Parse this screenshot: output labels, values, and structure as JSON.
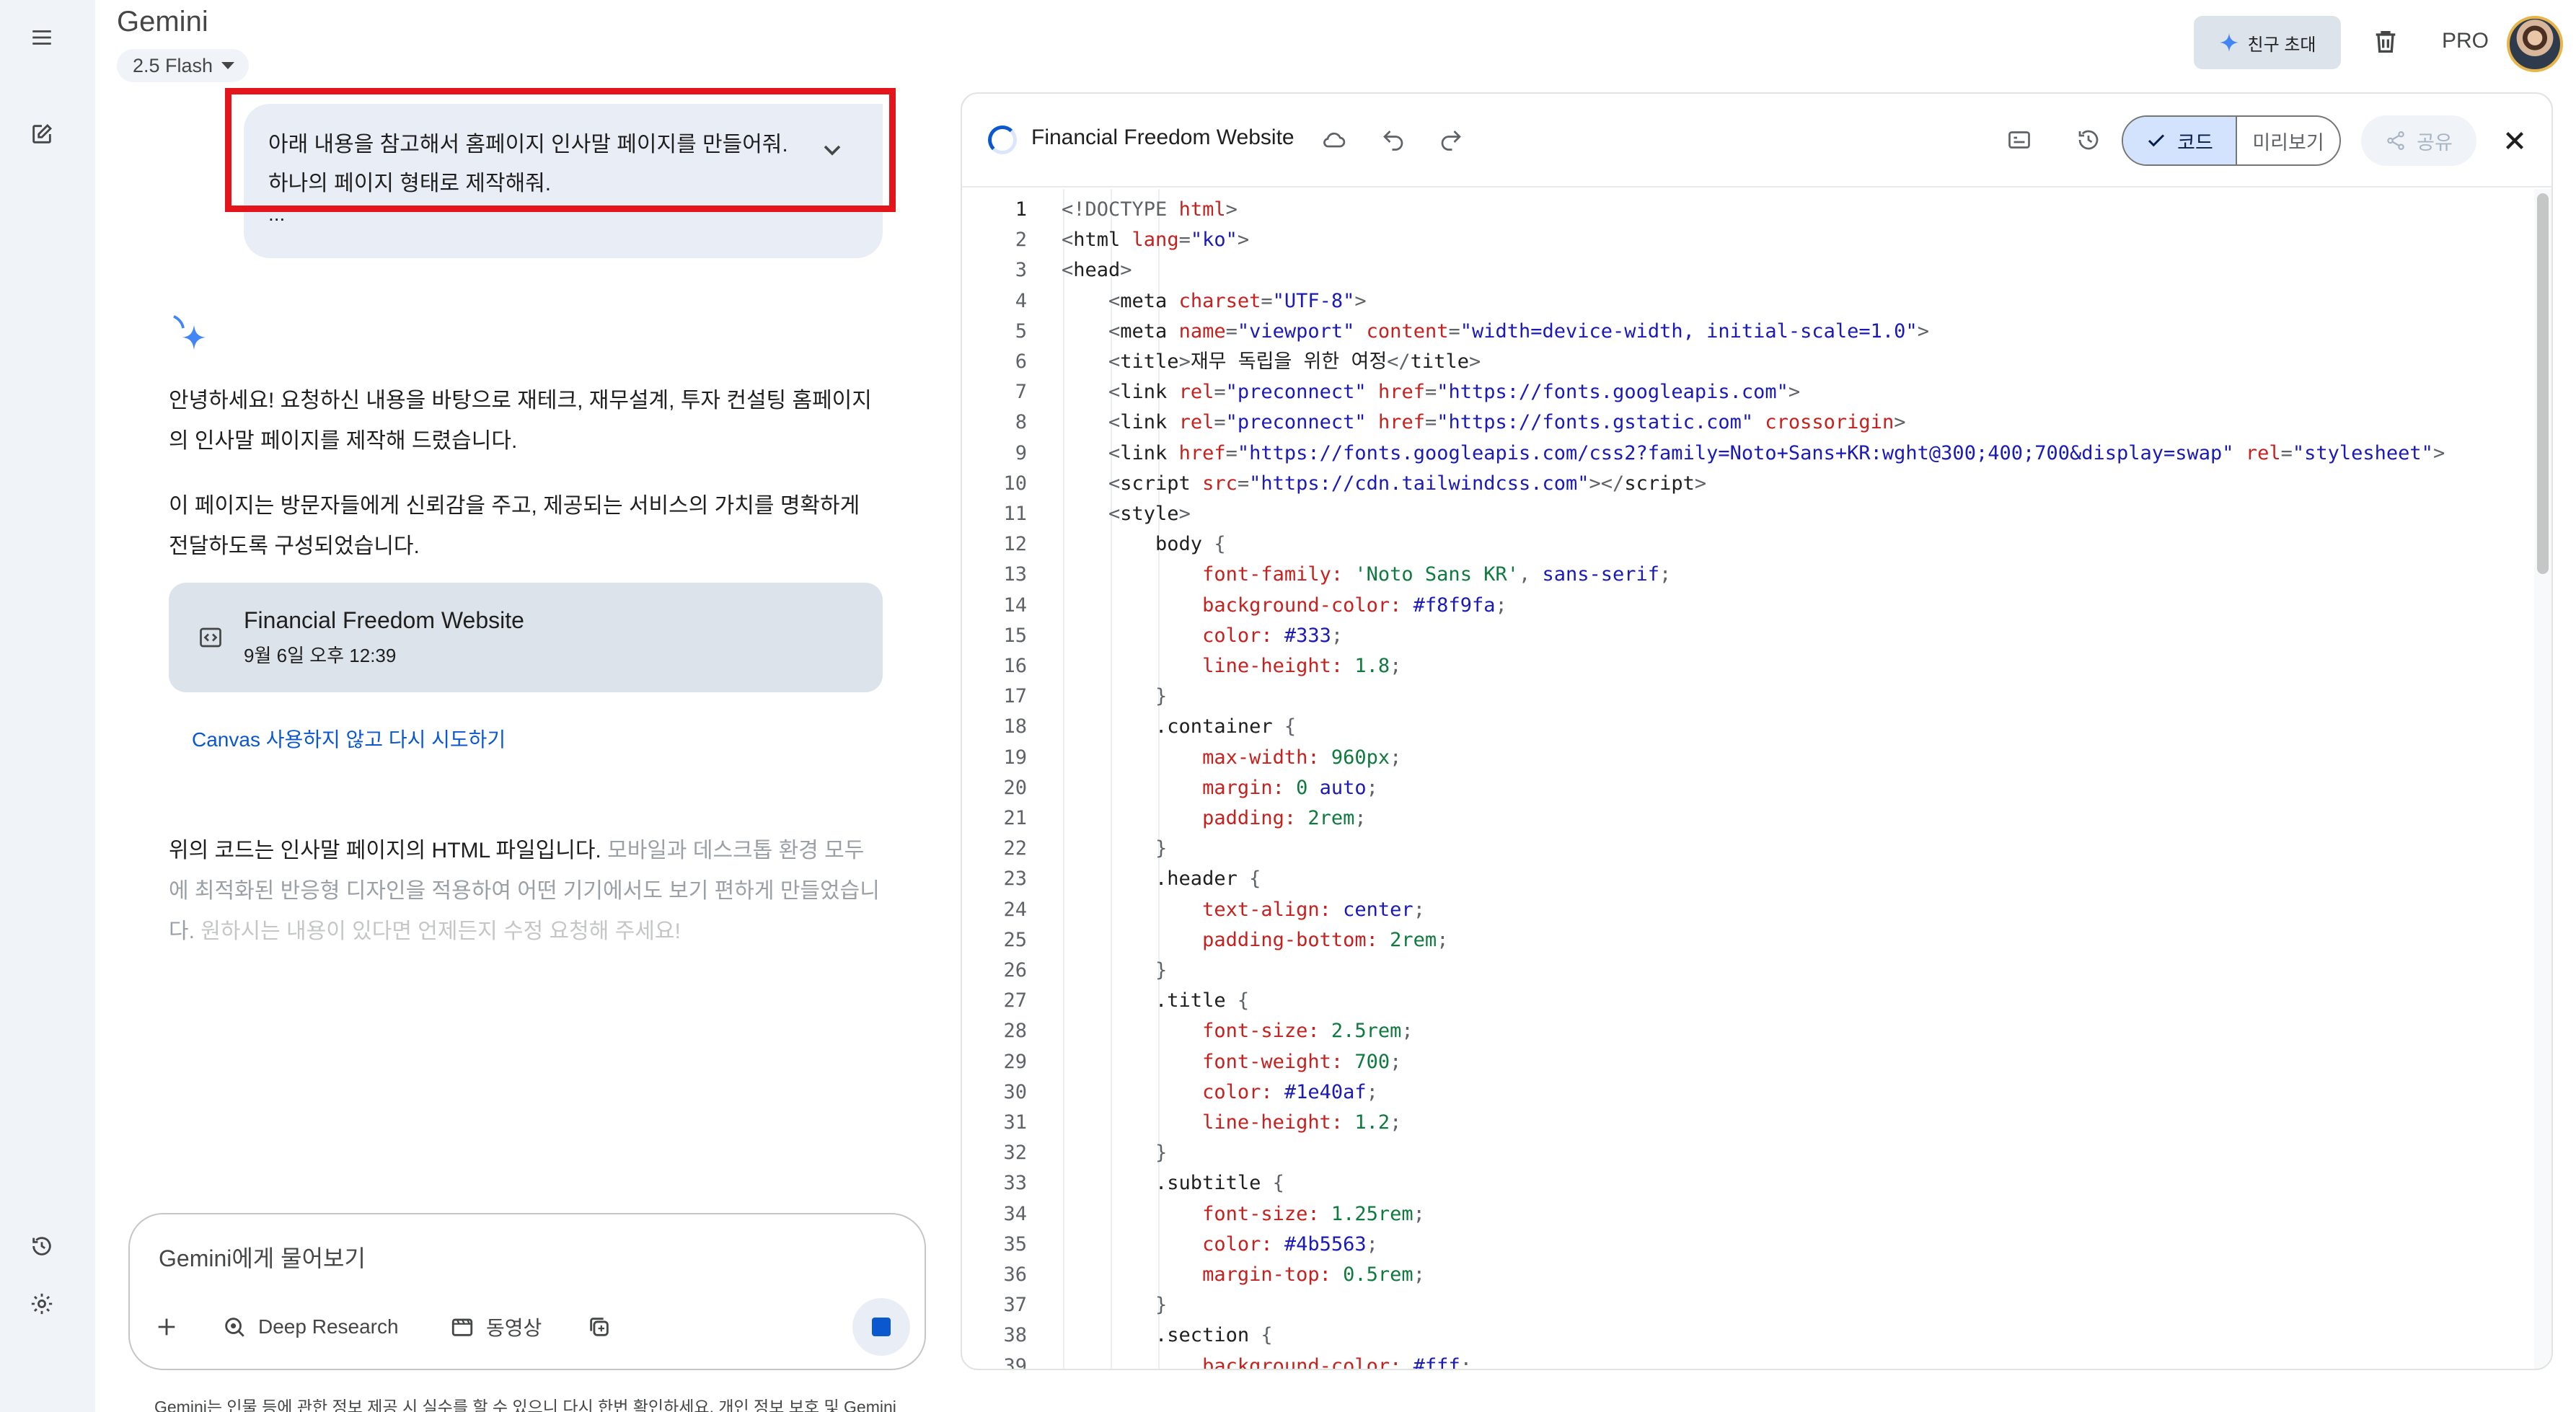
{
  "app": {
    "brand": "Gemini",
    "model_label": "2.5 Flash",
    "invite_label": "친구 초대",
    "plan_label": "PRO"
  },
  "chat": {
    "user_message_lines": [
      "아래 내용을 참고해서 홈페이지 인사말 페이지를 만들어줘.",
      "하나의 페이지 형태로 제작해줘.",
      "..."
    ],
    "response_p1_lines": [
      "안녕하세요! 요청하신 내용을 바탕으로 재테크, 재무설계, 투자 컨설팅 홈페이지",
      "의 인사말 페이지를 제작해 드렸습니다."
    ],
    "response_p2_lines": [
      "이 페이지는 방문자들에게 신뢰감을 주고, 제공되는 서비스의 가치를 명확하게",
      "전달하도록 구성되었습니다."
    ],
    "doc_card": {
      "title": "Financial Freedom Website",
      "date": "9월 6일 오후 12:39"
    },
    "retry_link": "Canvas 사용하지 않고 다시 시도하기",
    "response_p3": {
      "line1_a": "위의 코드는 인사말 페이지의 HTML 파일입니다. ",
      "line1_b": "모바일과 데스크톱 환경 모두",
      "line2": "에 최적화된 반응형 디자인을 적용하여 어떤 기기에서도 보기 편하게 만들었습니",
      "line3_a": "다. ",
      "line3_b": "원하시는 내용이 있다면 언제든지 수정 요청해 주세요!"
    }
  },
  "input": {
    "placeholder": "Gemini에게 물어보기",
    "tools": {
      "deep_research": "Deep Research",
      "video": "동영상"
    },
    "disclaimer": "Gemini는 인물 등에 관한 정보 제공 시 실수를 할 수 있으니 다시 한번 확인하세요. 개인 정보 보호 및 Gemini"
  },
  "canvas": {
    "title": "Financial Freedom Website",
    "code_tab": "코드",
    "preview_tab": "미리보기",
    "share_label": "공유",
    "code_lines": [
      [
        [
          "t-punc",
          "<!DOCTYPE "
        ],
        [
          "t-attr",
          "html"
        ],
        [
          "t-punc",
          ">"
        ]
      ],
      [
        [
          "t-punc",
          "<"
        ],
        [
          "t-tag",
          "html "
        ],
        [
          "t-attr",
          "lang"
        ],
        [
          "t-punc",
          "="
        ],
        [
          "t-str",
          "\"ko\""
        ],
        [
          "t-punc",
          ">"
        ]
      ],
      [
        [
          "t-punc",
          "<"
        ],
        [
          "t-tag",
          "head"
        ],
        [
          "t-punc",
          ">"
        ]
      ],
      [
        [
          "t-punc",
          "    <"
        ],
        [
          "t-tag",
          "meta "
        ],
        [
          "t-attr",
          "charset"
        ],
        [
          "t-punc",
          "="
        ],
        [
          "t-str",
          "\"UTF-8\""
        ],
        [
          "t-punc",
          ">"
        ]
      ],
      [
        [
          "t-punc",
          "    <"
        ],
        [
          "t-tag",
          "meta "
        ],
        [
          "t-attr",
          "name"
        ],
        [
          "t-punc",
          "="
        ],
        [
          "t-str",
          "\"viewport\" "
        ],
        [
          "t-attr",
          "content"
        ],
        [
          "t-punc",
          "="
        ],
        [
          "t-str",
          "\"width=device-width, initial-scale=1.0\""
        ],
        [
          "t-punc",
          ">"
        ]
      ],
      [
        [
          "t-punc",
          "    <"
        ],
        [
          "t-tag",
          "title"
        ],
        [
          "t-punc",
          ">"
        ],
        [
          "t-tag",
          "재무 독립을 위한 여정"
        ],
        [
          "t-punc",
          "</"
        ],
        [
          "t-tag",
          "title"
        ],
        [
          "t-punc",
          ">"
        ]
      ],
      [
        [
          "t-punc",
          "    <"
        ],
        [
          "t-tag",
          "link "
        ],
        [
          "t-attr",
          "rel"
        ],
        [
          "t-punc",
          "="
        ],
        [
          "t-str",
          "\"preconnect\" "
        ],
        [
          "t-attr",
          "href"
        ],
        [
          "t-punc",
          "="
        ],
        [
          "t-str",
          "\"https://fonts.googleapis.com\""
        ],
        [
          "t-punc",
          ">"
        ]
      ],
      [
        [
          "t-punc",
          "    <"
        ],
        [
          "t-tag",
          "link "
        ],
        [
          "t-attr",
          "rel"
        ],
        [
          "t-punc",
          "="
        ],
        [
          "t-str",
          "\"preconnect\" "
        ],
        [
          "t-attr",
          "href"
        ],
        [
          "t-punc",
          "="
        ],
        [
          "t-str",
          "\"https://fonts.gstatic.com\" "
        ],
        [
          "t-attr",
          "crossorigin"
        ],
        [
          "t-punc",
          ">"
        ]
      ],
      [
        [
          "t-punc",
          "    <"
        ],
        [
          "t-tag",
          "link "
        ],
        [
          "t-attr",
          "href"
        ],
        [
          "t-punc",
          "="
        ],
        [
          "t-str",
          "\"https://fonts.googleapis.com/css2?family=Noto+Sans+KR:wght@300;400;700&display=swap\" "
        ],
        [
          "t-attr",
          "rel"
        ],
        [
          "t-punc",
          "="
        ],
        [
          "t-str",
          "\"stylesheet\""
        ],
        [
          "t-punc",
          ">"
        ]
      ],
      [
        [
          "t-punc",
          "    <"
        ],
        [
          "t-tag",
          "script "
        ],
        [
          "t-attr",
          "src"
        ],
        [
          "t-punc",
          "="
        ],
        [
          "t-str",
          "\"https://cdn.tailwindcss.com\""
        ],
        [
          "t-punc",
          "></"
        ],
        [
          "t-tag",
          "script"
        ],
        [
          "t-punc",
          ">"
        ]
      ],
      [
        [
          "t-punc",
          "    <"
        ],
        [
          "t-tag",
          "style"
        ],
        [
          "t-punc",
          ">"
        ]
      ],
      [
        [
          "t-sel",
          "        body "
        ],
        [
          "t-punc",
          "{"
        ]
      ],
      [
        [
          "t-prop",
          "            font-family: "
        ],
        [
          "t-val",
          "'Noto Sans KR'"
        ],
        [
          "t-punc",
          ", "
        ],
        [
          "t-str",
          "sans-serif"
        ],
        [
          "t-punc",
          ";"
        ]
      ],
      [
        [
          "t-prop",
          "            background-color: "
        ],
        [
          "t-str",
          "#f8f9fa"
        ],
        [
          "t-punc",
          ";"
        ]
      ],
      [
        [
          "t-prop",
          "            color: "
        ],
        [
          "t-str",
          "#333"
        ],
        [
          "t-punc",
          ";"
        ]
      ],
      [
        [
          "t-prop",
          "            line-height: "
        ],
        [
          "t-num",
          "1.8"
        ],
        [
          "t-punc",
          ";"
        ]
      ],
      [
        [
          "t-punc",
          "        }"
        ]
      ],
      [
        [
          "t-sel",
          "        .container "
        ],
        [
          "t-punc",
          "{"
        ]
      ],
      [
        [
          "t-prop",
          "            max-width: "
        ],
        [
          "t-num",
          "960px"
        ],
        [
          "t-punc",
          ";"
        ]
      ],
      [
        [
          "t-prop",
          "            margin: "
        ],
        [
          "t-num",
          "0 "
        ],
        [
          "t-str",
          "auto"
        ],
        [
          "t-punc",
          ";"
        ]
      ],
      [
        [
          "t-prop",
          "            padding: "
        ],
        [
          "t-num",
          "2rem"
        ],
        [
          "t-punc",
          ";"
        ]
      ],
      [
        [
          "t-punc",
          "        }"
        ]
      ],
      [
        [
          "t-sel",
          "        .header "
        ],
        [
          "t-punc",
          "{"
        ]
      ],
      [
        [
          "t-prop",
          "            text-align: "
        ],
        [
          "t-str",
          "center"
        ],
        [
          "t-punc",
          ";"
        ]
      ],
      [
        [
          "t-prop",
          "            padding-bottom: "
        ],
        [
          "t-num",
          "2rem"
        ],
        [
          "t-punc",
          ";"
        ]
      ],
      [
        [
          "t-punc",
          "        }"
        ]
      ],
      [
        [
          "t-sel",
          "        .title "
        ],
        [
          "t-punc",
          "{"
        ]
      ],
      [
        [
          "t-prop",
          "            font-size: "
        ],
        [
          "t-num",
          "2.5rem"
        ],
        [
          "t-punc",
          ";"
        ]
      ],
      [
        [
          "t-prop",
          "            font-weight: "
        ],
        [
          "t-num",
          "700"
        ],
        [
          "t-punc",
          ";"
        ]
      ],
      [
        [
          "t-prop",
          "            color: "
        ],
        [
          "t-str",
          "#1e40af"
        ],
        [
          "t-punc",
          ";"
        ]
      ],
      [
        [
          "t-prop",
          "            line-height: "
        ],
        [
          "t-num",
          "1.2"
        ],
        [
          "t-punc",
          ";"
        ]
      ],
      [
        [
          "t-punc",
          "        }"
        ]
      ],
      [
        [
          "t-sel",
          "        .subtitle "
        ],
        [
          "t-punc",
          "{"
        ]
      ],
      [
        [
          "t-prop",
          "            font-size: "
        ],
        [
          "t-num",
          "1.25rem"
        ],
        [
          "t-punc",
          ";"
        ]
      ],
      [
        [
          "t-prop",
          "            color: "
        ],
        [
          "t-str",
          "#4b5563"
        ],
        [
          "t-punc",
          ";"
        ]
      ],
      [
        [
          "t-prop",
          "            margin-top: "
        ],
        [
          "t-num",
          "0.5rem"
        ],
        [
          "t-punc",
          ";"
        ]
      ],
      [
        [
          "t-punc",
          "        }"
        ]
      ],
      [
        [
          "t-sel",
          "        .section "
        ],
        [
          "t-punc",
          "{"
        ]
      ],
      [
        [
          "t-prop",
          "            background-color: "
        ],
        [
          "t-str",
          "#fff"
        ],
        [
          "t-punc",
          ";"
        ]
      ]
    ]
  },
  "colors": {
    "accent": "#0b57d0",
    "highlight_box": "#e3141b",
    "rail_bg": "#f0f4f9"
  },
  "icons": [
    "menu-icon",
    "new-chat-icon",
    "history-icon",
    "settings-icon",
    "sparkle-icon",
    "invite-sparkle-icon",
    "trash-icon",
    "code-doc-icon",
    "chevron-down-icon",
    "plus-icon",
    "deep-research-icon",
    "video-icon",
    "canvas-tool-icon",
    "stop-icon",
    "cloud-icon",
    "undo-icon",
    "redo-icon",
    "terminal-icon",
    "version-history-icon",
    "check-icon",
    "share-icon",
    "close-icon"
  ]
}
